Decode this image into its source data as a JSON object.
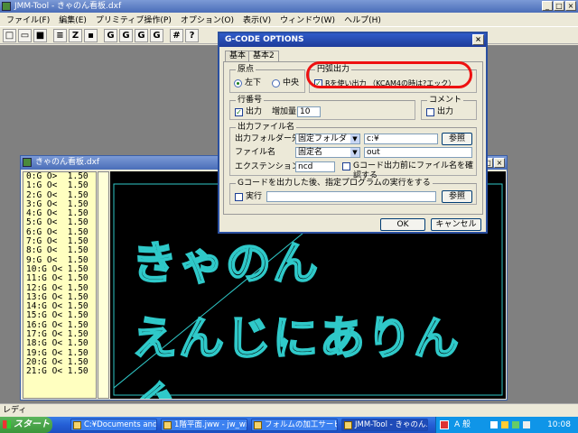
{
  "app": {
    "title": "JMM-Tool - きゃのん看板.dxf",
    "menu": [
      "ファイル(F)",
      "編集(E)",
      "プリミティブ操作(P)",
      "オプション(O)",
      "表示(V)",
      "ウィンドウ(W)",
      "ヘルプ(H)"
    ],
    "toolbar": [
      "G",
      "G",
      "G",
      "G",
      "?"
    ],
    "status": "レディ"
  },
  "doc": {
    "title": "きゃのん看板.dxf",
    "nc_lines": [
      "0:G O>  1.50",
      "1:G O<  1.50",
      "2:G O<  1.50",
      "3:G O<  1.50",
      "4:G O<  1.50",
      "5:G O<  1.50",
      "6:G O<  1.50",
      "7:G O<  1.50",
      "8:G O<  1.50",
      "9:G O<  1.50",
      "10:G O< 1.50",
      "11:G O< 1.50",
      "12:G O< 1.50",
      "13:G O< 1.50",
      "14:G O< 1.50",
      "15:G O< 1.50",
      "16:G O< 1.50",
      "17:G O< 1.50",
      "18:G O< 1.50",
      "19:G O< 1.50",
      "20:G O< 1.50",
      "21:G O< 1.50"
    ],
    "canvas_line1": "きゃのん",
    "canvas_line2": "えんじにありんぐ"
  },
  "dialog": {
    "title": "G-CODE OPTIONS",
    "tabs": [
      "基本",
      "基本2"
    ],
    "origin": {
      "label": "原点",
      "opt1": "左下",
      "opt2": "中央"
    },
    "arc": {
      "label": "円弧出力",
      "chk": "Rを使い出力 （KCAM4の時は?エック）"
    },
    "lineno": {
      "label": "行番号",
      "out": "出力",
      "inc_label": "増加量",
      "inc_value": "10"
    },
    "comment": {
      "label": "コメント",
      "out": "出力"
    },
    "outfile": {
      "label": "出力ファイル名",
      "folder_label": "出力フォルダー先",
      "folder_combo": "固定フォルダ",
      "folder_value": "c:¥",
      "browse": "参照",
      "name_label": "ファイル名",
      "name_combo": "固定名",
      "name_value": "out",
      "ext_label": "エクステンション",
      "ext_value": "ncd",
      "confirm": "Gコード出力前にファイル名を確認する"
    },
    "exec": {
      "label": "Gコードを出力した後、指定プログラムの実行をする",
      "chk": "実行",
      "browse": "参照"
    },
    "ok": "OK",
    "cancel": "キャンセル"
  },
  "taskbar": {
    "start": "スタート",
    "tasks": [
      "C:¥Documents and S...",
      "1階平面.jww - jw_win",
      "フォルムの加工サービス...",
      "JMM-Tool - きゃのん..."
    ],
    "tray_ime": "A 般",
    "time": "10:08"
  },
  "colors": {
    "canvas_bg": "#000000",
    "text_outline": "#2fc9c9",
    "nc_bg": "#ffffc0",
    "highlight": "#e11111"
  }
}
